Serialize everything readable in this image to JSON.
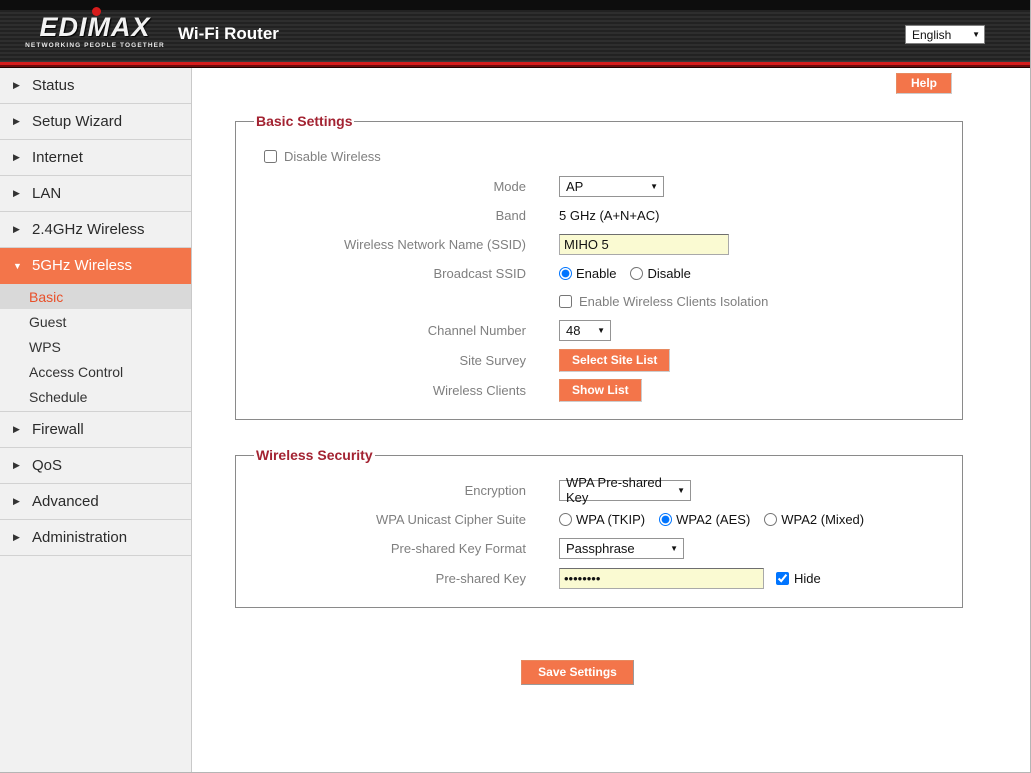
{
  "icons": {
    "dropdown_arrow": "▼",
    "nav_collapsed": "▶",
    "nav_expanded": "▼"
  },
  "colors": {
    "accent_orange": "#f3754a",
    "header_red": "#d61c1c",
    "legend_red": "#a32332",
    "submenu_active_text": "#e8502a",
    "input_yellow": "#fafad2"
  },
  "header": {
    "logo_text": "EDIMAX",
    "logo_tagline": "NETWORKING PEOPLE TOGETHER",
    "title": "Wi-Fi Router",
    "language": "English"
  },
  "sidebar": {
    "items": [
      {
        "label": "Status"
      },
      {
        "label": "Setup Wizard"
      },
      {
        "label": "Internet"
      },
      {
        "label": "LAN"
      },
      {
        "label": "2.4GHz Wireless"
      },
      {
        "label": "5GHz Wireless",
        "active": true
      },
      {
        "label": "Firewall"
      },
      {
        "label": "QoS"
      },
      {
        "label": "Advanced"
      },
      {
        "label": "Administration"
      }
    ],
    "submenu": [
      {
        "label": "Basic",
        "selected": true
      },
      {
        "label": "Guest"
      },
      {
        "label": "WPS"
      },
      {
        "label": "Access Control"
      },
      {
        "label": "Schedule"
      }
    ]
  },
  "content": {
    "help_label": "Help",
    "save_label": "Save Settings"
  },
  "basic": {
    "legend": "Basic Settings",
    "disable_wireless_label": "Disable Wireless",
    "mode_label": "Mode",
    "mode_value": "AP",
    "band_label": "Band",
    "band_value": "5 GHz (A+N+AC)",
    "ssid_label": "Wireless Network Name (SSID)",
    "ssid_value": "MIHO 5",
    "broadcast_label": "Broadcast SSID",
    "broadcast_enable_label": "Enable",
    "broadcast_disable_label": "Disable",
    "broadcast_selected": "Enable",
    "isolation_label": "Enable Wireless Clients Isolation",
    "channel_label": "Channel Number",
    "channel_value": "48",
    "site_survey_label": "Site Survey",
    "site_survey_button": "Select Site List",
    "wireless_clients_label": "Wireless Clients",
    "show_list_button": "Show List"
  },
  "security": {
    "legend": "Wireless Security",
    "encryption_label": "Encryption",
    "encryption_value": "WPA Pre-shared Key",
    "cipher_label": "WPA Unicast Cipher Suite",
    "cipher_options": [
      "WPA (TKIP)",
      "WPA2 (AES)",
      "WPA2 (Mixed)"
    ],
    "cipher_selected": "WPA2 (AES)",
    "key_format_label": "Pre-shared Key Format",
    "key_format_value": "Passphrase",
    "key_label": "Pre-shared Key",
    "key_masked_value": "••••••••",
    "hide_label": "Hide"
  }
}
